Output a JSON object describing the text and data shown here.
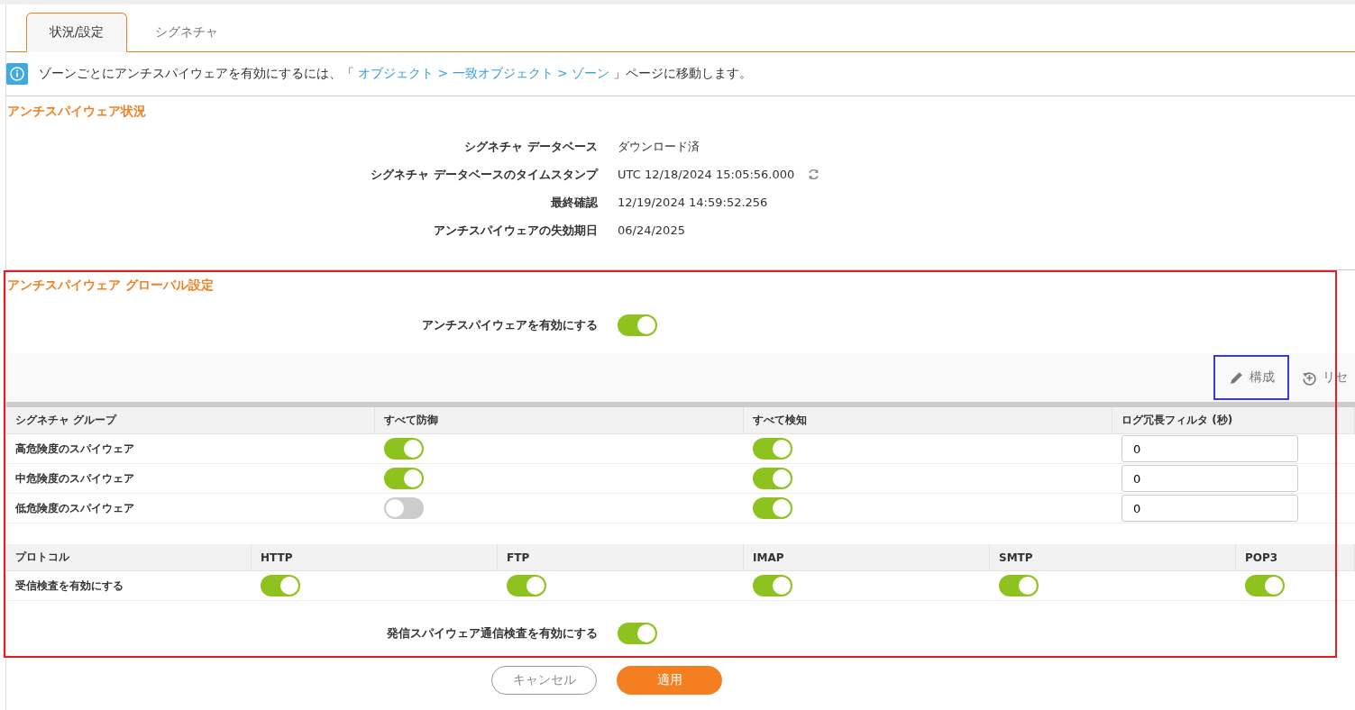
{
  "tabs": [
    {
      "label": "状況/設定",
      "selected": true
    },
    {
      "label": "シグネチャ",
      "selected": false
    }
  ],
  "info": {
    "before": "ゾーンごとにアンチスパイウェアを有効にするには、「",
    "link": "オブジェクト > 一致オブジェクト > ゾーン",
    "after": "」ページに移動します。"
  },
  "status": {
    "title": "アンチスパイウェア状況",
    "rows": [
      {
        "label": "シグネチャ データベース",
        "value": "ダウンロード済",
        "refresh": false
      },
      {
        "label": "シグネチャ データベースのタイムスタンプ",
        "value": "UTC 12/18/2024 15:05:56.000",
        "refresh": true
      },
      {
        "label": "最終確認",
        "value": "12/19/2024 14:59:52.256",
        "refresh": false
      },
      {
        "label": "アンチスパイウェアの失効期日",
        "value": "06/24/2025",
        "refresh": false
      }
    ]
  },
  "global": {
    "title": "アンチスパイウェア グローバル設定",
    "enable_label": "アンチスパイウェアを有効にする",
    "enable_on": true,
    "toolbar": {
      "configure": "構成",
      "reset": "リセ"
    },
    "groups": {
      "columns": [
        "シグネチャ グループ",
        "すべて防御",
        "すべて検知",
        "ログ冗長フィルタ (秒)"
      ],
      "rows": [
        {
          "name": "高危険度のスパイウェア",
          "prevent": true,
          "detect": true,
          "filter": "0"
        },
        {
          "name": "中危険度のスパイウェア",
          "prevent": true,
          "detect": true,
          "filter": "0"
        },
        {
          "name": "低危険度のスパイウェア",
          "prevent": false,
          "detect": true,
          "filter": "0"
        }
      ]
    },
    "protocols": {
      "columns": [
        "プロトコル",
        "HTTP",
        "FTP",
        "IMAP",
        "SMTP",
        "POP3"
      ],
      "row_label": "受信検査を有効にする",
      "on": [
        true,
        true,
        true,
        true,
        true
      ]
    },
    "outbound_label": "発信スパイウェア通信検査を有効にする",
    "outbound_on": true
  },
  "buttons": {
    "cancel": "キャンセル",
    "apply": "適用"
  }
}
